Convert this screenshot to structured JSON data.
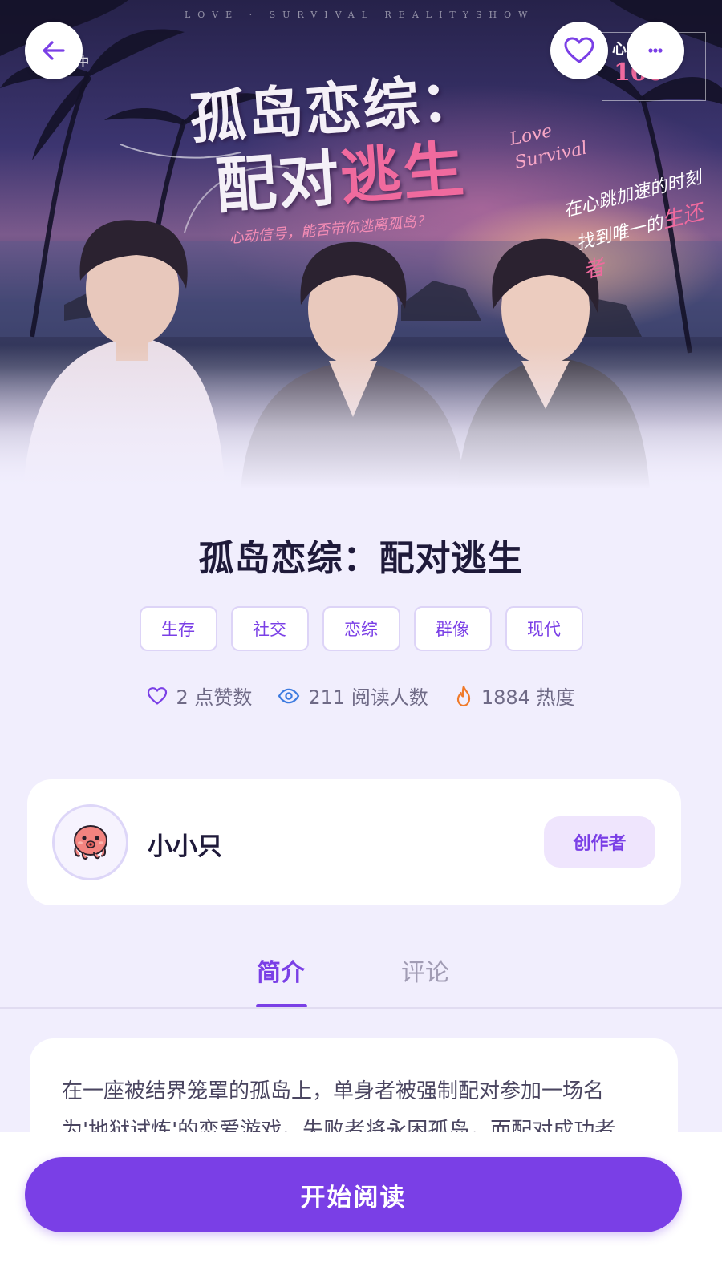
{
  "cover": {
    "top_text": "LOVE · SURVIVAL REALITYSHOW",
    "corner_left": "中",
    "title_line1": "孤岛恋综：",
    "title_line2_a": "配对",
    "title_line2_b": "逃生",
    "script_text_1": "Love",
    "script_text_2": "Survival",
    "subtitle": "心动信号，能否带你逃离孤岛？",
    "side_line1": "在心跳加速的时刻",
    "side_line2_a": "找到唯一的",
    "side_line2_b": "生还者",
    "badge_top": "心",
    "badge_number": "100"
  },
  "header": {
    "back_icon": "arrow-left-icon",
    "favorite_icon": "heart-outline-icon",
    "more_icon": "ellipsis-icon"
  },
  "story": {
    "title": "孤岛恋综：配对逃生",
    "tags": [
      "生存",
      "社交",
      "恋综",
      "群像",
      "现代"
    ],
    "stats": {
      "likes": "2 点赞数",
      "readers": "211 阅读人数",
      "heat": "1884 热度"
    }
  },
  "author": {
    "name": "小小只",
    "role_badge": "创作者",
    "avatar_icon": "octopus-icon"
  },
  "tabs": {
    "intro": "简介",
    "comments": "评论",
    "active": "intro"
  },
  "intro": {
    "text": "在一座被结界笼罩的孤岛上，单身者被强制配对参加一场名为'地狱试炼'的恋爱游戏。失败者将永困孤岛，而配对成功者"
  },
  "bottom": {
    "read_button": "开始阅读"
  },
  "colors": {
    "accent": "#7a3fe6",
    "page_bg": "#f1eefd",
    "tag_border": "#ddd4f7",
    "creator_badge_bg": "#efe5fd",
    "heat_icon": "#f07a2a",
    "eye_icon": "#3d7be0"
  }
}
